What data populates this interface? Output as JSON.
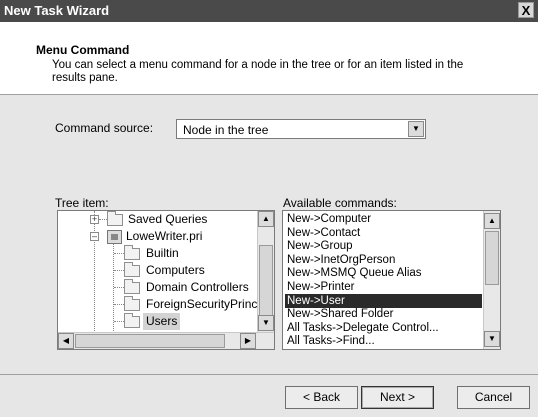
{
  "window": {
    "title": "New Task Wizard",
    "close_glyph": "X"
  },
  "header": {
    "title": "Menu Command",
    "description": "You can select a menu command for a node in the tree or for an item listed in the results pane."
  },
  "command_source": {
    "label": "Command source:",
    "value": "Node in the tree"
  },
  "tree": {
    "label": "Tree item:",
    "items": [
      {
        "label": "Saved Queries",
        "icon": "folder-icon"
      },
      {
        "label": "LoweWriter.pri",
        "icon": "domain-icon"
      },
      {
        "label": "Builtin",
        "icon": "folder-icon"
      },
      {
        "label": "Computers",
        "icon": "folder-icon"
      },
      {
        "label": "Domain Controllers",
        "icon": "folder-icon"
      },
      {
        "label": "ForeignSecurityPrincip",
        "icon": "folder-icon"
      },
      {
        "label": "Users",
        "icon": "folder-icon",
        "selected": true
      }
    ]
  },
  "commands": {
    "label": "Available commands:",
    "items": [
      "New->Computer",
      "New->Contact",
      "New->Group",
      "New->InetOrgPerson",
      "New->MSMQ Queue Alias",
      "New->Printer",
      "New->User",
      "New->Shared Folder",
      "All Tasks->Delegate Control...",
      "All Tasks->Find..."
    ],
    "selected_index": 6
  },
  "buttons": {
    "back": "< Back",
    "next": "Next >",
    "cancel": "Cancel"
  },
  "icons": {
    "scroll_up": "▲",
    "scroll_down": "▼",
    "scroll_left": "◀",
    "scroll_right": "▶",
    "dropdown": "▼"
  }
}
